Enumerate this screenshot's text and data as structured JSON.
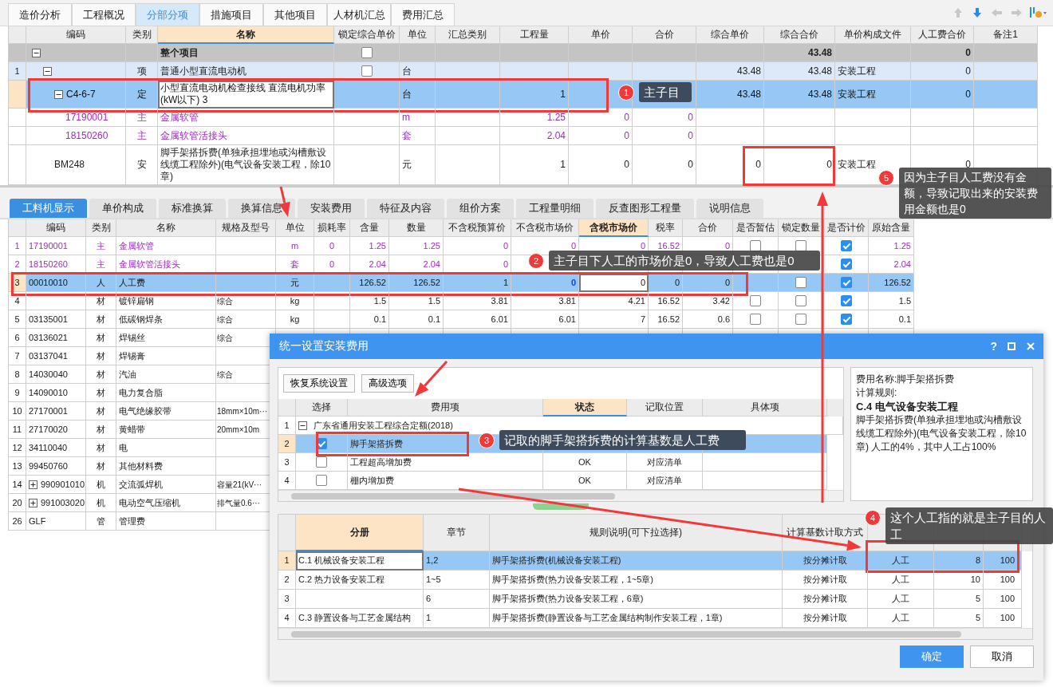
{
  "tabs": [
    {
      "label": "造价分析",
      "selected": false
    },
    {
      "label": "工程概况",
      "selected": false
    },
    {
      "label": "分部分项",
      "selected": true
    },
    {
      "label": "措施项目",
      "selected": false
    },
    {
      "label": "其他项目",
      "selected": false
    },
    {
      "label": "人材机汇总",
      "selected": false
    },
    {
      "label": "费用汇总",
      "selected": false
    }
  ],
  "toolbar": [
    {
      "kind": "up",
      "disabled": true
    },
    {
      "kind": "down",
      "disabled": false
    },
    {
      "kind": "left",
      "disabled": true
    },
    {
      "kind": "right",
      "disabled": true
    },
    {
      "kind": "settings",
      "disabled": false
    }
  ],
  "top_table": {
    "columns": [
      {
        "label": "编码",
        "selected": false
      },
      {
        "label": "类别",
        "selected": false
      },
      {
        "label": "名称",
        "selected": true
      },
      {
        "label": "锁定综合单价",
        "selected": false
      },
      {
        "label": "单位",
        "selected": false
      },
      {
        "label": "汇总类别",
        "selected": false
      },
      {
        "label": "工程量",
        "selected": false
      },
      {
        "label": "单价",
        "selected": false
      },
      {
        "label": "合价",
        "selected": false
      },
      {
        "label": "综合单价",
        "selected": false
      },
      {
        "label": "综合合价",
        "selected": false
      },
      {
        "label": "单价构成文件",
        "selected": false
      },
      {
        "label": "人工费合价",
        "selected": false
      },
      {
        "label": "备注1",
        "selected": false
      }
    ],
    "rows": [
      {
        "kind": "summary",
        "name": "整个项目",
        "locked": false,
        "comp_total": "43.48",
        "labor": "0",
        "expanded": true,
        "selected": false,
        "children": [
          {
            "kind": "item",
            "num": "1",
            "type": "项",
            "name": "普通小型直流电动机",
            "locked": false,
            "unit": "台",
            "comp_price": "43.48",
            "comp_total": "43.48",
            "file": "安装工程",
            "labor": "0",
            "expanded": true,
            "selected": false,
            "children": [
              {
                "kind": "quota",
                "code": "C4-6-7",
                "type": "定",
                "name": "小型直流电动机检查接线 直流电机功率(kW以下) 3",
                "unit": "台",
                "qty": "1",
                "comp_price": "43.48",
                "comp_total": "43.48",
                "file": "安装工程",
                "labor": "0",
                "expanded": true,
                "selected": true,
                "children": [
                  {
                    "kind": "main_material",
                    "code": "17190001",
                    "type": "主",
                    "name": "金属软管",
                    "unit": "m",
                    "qty": "1.25",
                    "price": "0",
                    "total": "0",
                    "selected": false
                  },
                  {
                    "kind": "main_material",
                    "code": "18150260",
                    "type": "主",
                    "name": "金属软管活接头",
                    "unit": "套",
                    "qty": "2.04",
                    "price": "0",
                    "total": "0",
                    "selected": false
                  }
                ]
              },
              {
                "kind": "install",
                "code": "BM248",
                "type": "安",
                "name": "脚手架搭拆费(单独承担埋地或沟槽敷设线缆工程除外)(电气设备安装工程，除10章)",
                "unit": "元",
                "qty": "1",
                "price": "0",
                "total": "0",
                "comp_price": "0",
                "comp_total": "0",
                "file": "安装工程",
                "labor": "0",
                "selected": false
              }
            ]
          }
        ]
      }
    ]
  },
  "detail_tabs": [
    {
      "label": "工料机显示",
      "selected": true
    },
    {
      "label": "单价构成",
      "selected": false
    },
    {
      "label": "标准换算",
      "selected": false
    },
    {
      "label": "换算信息",
      "selected": false
    },
    {
      "label": "安装费用",
      "selected": false
    },
    {
      "label": "特征及内容",
      "selected": false
    },
    {
      "label": "组价方案",
      "selected": false
    },
    {
      "label": "工程量明细",
      "selected": false
    },
    {
      "label": "反查图形工程量",
      "selected": false
    },
    {
      "label": "说明信息",
      "selected": false
    }
  ],
  "detail_table": {
    "columns": [
      {
        "label": "编码",
        "selected": false
      },
      {
        "label": "类别",
        "selected": false
      },
      {
        "label": "名称",
        "selected": false
      },
      {
        "label": "规格及型号",
        "selected": false
      },
      {
        "label": "单位",
        "selected": false
      },
      {
        "label": "损耗率",
        "selected": false
      },
      {
        "label": "含量",
        "selected": false
      },
      {
        "label": "数量",
        "selected": false
      },
      {
        "label": "不含税预算价",
        "selected": false
      },
      {
        "label": "不含税市场价",
        "selected": false
      },
      {
        "label": "含税市场价",
        "selected": true
      },
      {
        "label": "税率",
        "selected": false
      },
      {
        "label": "合价",
        "selected": false
      },
      {
        "label": "是否暂估",
        "selected": false
      },
      {
        "label": "锁定数量",
        "selected": false
      },
      {
        "label": "是否计价",
        "selected": false
      },
      {
        "label": "原始含量",
        "selected": false
      }
    ],
    "rows": [
      {
        "kind": "main_material",
        "num": "1",
        "code": "17190001",
        "type": "主",
        "name": "金属软管",
        "unit": "m",
        "loss": "0",
        "content": "1.25",
        "qty": "1.25",
        "budget": "0",
        "market": "0",
        "tax_market": "0",
        "tax_rate": "16.52",
        "total": "0",
        "estimate": false,
        "lock_qty": false,
        "priced": true,
        "orig": "1.25",
        "selected": false
      },
      {
        "kind": "main_material",
        "num": "2",
        "code": "18150260",
        "type": "主",
        "name": "金属软管活接头",
        "unit": "套",
        "loss": "0",
        "content": "2.04",
        "qty": "2.04",
        "budget": "0",
        "priced": true,
        "orig": "2.04",
        "selected": false
      },
      {
        "kind": "labor",
        "num": "3",
        "code": "00010010",
        "type": "人",
        "name": "人工费",
        "unit": "元",
        "content": "126.52",
        "qty": "126.52",
        "budget": "1",
        "market": "0",
        "tax_market": "0",
        "tax_rate": "0",
        "total": "0",
        "lock_qty": false,
        "priced": true,
        "orig": "126.52",
        "selected": true
      },
      {
        "kind": "material",
        "num": "4",
        "type": "材",
        "name": "镀锌扁钢",
        "spec": "综合",
        "unit": "kg",
        "content": "1.5",
        "qty": "1.5",
        "budget": "3.81",
        "market": "3.81",
        "tax_market": "4.21",
        "tax_rate": "16.52",
        "total": "3.42",
        "estimate": false,
        "lock_qty": false,
        "priced": true,
        "orig": "1.5",
        "selected": false
      },
      {
        "kind": "material",
        "num": "5",
        "code": "03135001",
        "type": "材",
        "name": "低碳钢焊条",
        "spec": "综合",
        "unit": "kg",
        "content": "0.1",
        "qty": "0.1",
        "budget": "6.01",
        "market": "6.01",
        "tax_market": "7",
        "tax_rate": "16.52",
        "total": "0.6",
        "estimate": false,
        "lock_qty": false,
        "priced": true,
        "orig": "0.1",
        "selected": false
      },
      {
        "kind": "material",
        "num": "6",
        "code": "03136021",
        "type": "材",
        "name": "焊锡丝",
        "spec": "综合",
        "selected": false
      },
      {
        "kind": "material",
        "num": "7",
        "code": "03137041",
        "type": "材",
        "name": "焊锡膏",
        "selected": false
      },
      {
        "kind": "material",
        "num": "8",
        "code": "14030040",
        "type": "材",
        "name": "汽油",
        "spec": "综合",
        "selected": false
      },
      {
        "kind": "material",
        "num": "9",
        "code": "14090010",
        "type": "材",
        "name": "电力复合脂",
        "selected": false
      },
      {
        "kind": "material",
        "num": "10",
        "code": "27170001",
        "type": "材",
        "name": "电气绝缘胶带",
        "spec": "18mm×10m···",
        "selected": false
      },
      {
        "kind": "material",
        "num": "11",
        "code": "27170020",
        "type": "材",
        "name": "黄蜡带",
        "spec": "20mm×10m",
        "selected": false
      },
      {
        "kind": "material",
        "num": "12",
        "code": "34110040",
        "type": "材",
        "name": "电",
        "selected": false
      },
      {
        "kind": "material",
        "num": "13",
        "code": "99450760",
        "type": "材",
        "name": "其他材料费",
        "selected": false
      },
      {
        "kind": "machine",
        "num": "14",
        "code": "990901010",
        "type": "机",
        "name": "交流弧焊机",
        "spec": "容量21(kV···",
        "expanded": false,
        "selected": false
      },
      {
        "kind": "machine",
        "num": "20",
        "code": "991003020",
        "type": "机",
        "name": "电动空气压缩机",
        "spec": "排气量0.6···",
        "expanded": false,
        "selected": false
      },
      {
        "kind": "material",
        "num": "26",
        "code": "GLF",
        "type": "管",
        "name": "管理费",
        "selected": false
      }
    ]
  },
  "dialog": {
    "title": "统一设置安装费用",
    "help": "?",
    "buttons": [
      "恢复系统设置",
      "高级选项"
    ],
    "fee_table": {
      "columns": [
        {
          "label": "选择",
          "selected": false
        },
        {
          "label": "费用项",
          "selected": false
        },
        {
          "label": "状态",
          "selected": true
        },
        {
          "label": "记取位置",
          "selected": false
        },
        {
          "label": "具体项",
          "selected": false
        }
      ],
      "rows": [
        {
          "num": "1",
          "name": "广东省通用安装工程综合定额(2018)",
          "expanded": true,
          "selected": false,
          "children": [
            {
              "num": "2",
              "name": "脚手架搭拆费",
              "checked": true,
              "selected": true
            },
            {
              "num": "3",
              "name": "工程超高增加费",
              "checked": false,
              "status": "OK",
              "position": "对应清单",
              "selected": false
            },
            {
              "num": "4",
              "name": "棚内增加费",
              "checked": false,
              "status": "OK",
              "position": "对应清单",
              "selected": false
            }
          ]
        }
      ]
    },
    "info": {
      "name": "费用名称:脚手架搭拆费",
      "rule_label": "计算规则:",
      "section": "C.4 电气设备安装工程",
      "rule": "脚手架搭拆费(单独承担埋地或沟槽敷设线缆工程除外)(电气设备安装工程，除10章) 人工的4%，其中人工占100%"
    },
    "rule_table": {
      "columns": [
        {
          "label": "分册",
          "selected": true
        },
        {
          "label": "章节",
          "selected": false
        },
        {
          "label": "规则说明(可下拉选择)",
          "selected": false
        },
        {
          "label": "计算基数计取方式",
          "selected": false
        }
      ],
      "rows": [
        {
          "num": "1",
          "volume": "C.1 机械设备安装工程",
          "chapter": "1,2",
          "rule": "脚手架搭拆费(机械设备安装工程)",
          "method": "按分摊计取",
          "column_5": "人工",
          "column_6": "8",
          "column_7": "100",
          "selected": true
        },
        {
          "num": "2",
          "volume": "C.2 热力设备安装工程",
          "chapter": "1~5",
          "rule": "脚手架搭拆费(热力设备安装工程，1~5章)",
          "method": "按分摊计取",
          "column_5": "人工",
          "column_6": "10",
          "column_7": "100",
          "selected": false
        },
        {
          "num": "3",
          "chapter": "6",
          "rule": "脚手架搭拆费(热力设备安装工程，6章)",
          "method": "按分摊计取",
          "column_5": "人工",
          "column_6": "5",
          "column_7": "100",
          "selected": false
        },
        {
          "num": "4",
          "volume": "C.3 静置设备与工艺金属结构",
          "chapter": "1",
          "rule": "脚手架搭拆费(静置设备与工艺金属结构制作安装工程，1章)",
          "method": "按分摊计取",
          "column_5": "人工",
          "column_6": "5",
          "column_7": "100",
          "selected": false
        }
      ]
    },
    "actions": [
      {
        "label": "确定",
        "kind": "primary"
      },
      {
        "label": "取消",
        "kind": "normal"
      }
    ]
  },
  "annotations": [
    {
      "number": "1",
      "text": "主子目"
    },
    {
      "number": "5",
      "text": "因为主子目人工费没有金额，导致记取出来的安装费用金额也是0"
    },
    {
      "number": "2",
      "text": "主子目下人工的市场价是0，导致人工费也是0"
    },
    {
      "number": "3",
      "text": "记取的脚手架搭拆费的计算基数是人工费"
    },
    {
      "number": "4",
      "text": "这个人工指的就是主子目的人工"
    }
  ]
}
